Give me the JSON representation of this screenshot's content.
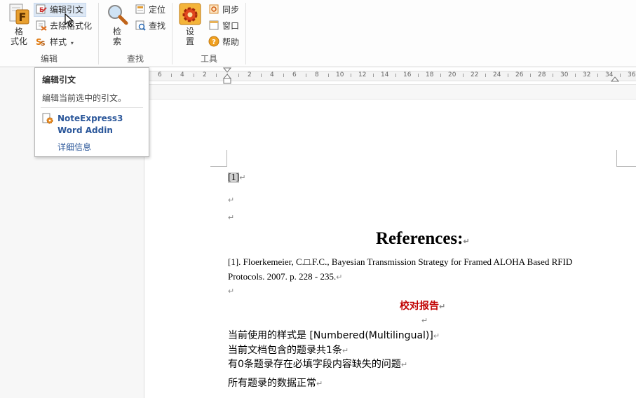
{
  "ribbon": {
    "groups": [
      {
        "label": "编辑"
      },
      {
        "label": "查找"
      },
      {
        "label": "工具"
      }
    ],
    "format_button": {
      "line1": "格",
      "line2": "式化"
    },
    "edit_citation": "编辑引文",
    "remove_format": "去除格式化",
    "style": "样式",
    "search_button": {
      "line1": "检",
      "line2": "索"
    },
    "locate": "定位",
    "find": "查找",
    "settings_button": {
      "line1": "设",
      "line2": "置"
    },
    "sync": "同步",
    "window": "窗口",
    "help": "帮助"
  },
  "ruler": {
    "numbers": [
      "6",
      "4",
      "2",
      "2",
      "4",
      "6",
      "8",
      "10",
      "12",
      "14",
      "16",
      "18",
      "20",
      "22",
      "24",
      "26",
      "28",
      "30",
      "32",
      "34",
      "36"
    ]
  },
  "tooltip": {
    "title": "编辑引文",
    "description": "编辑当前选中的引文。",
    "addin_name": "NoteExpress3 Word Addin",
    "more_info": "详细信息"
  },
  "document": {
    "citation": "[1]",
    "references_heading": "References:",
    "reference_line1": "[1]. Floerkemeier, C.□.F.C., Bayesian Transmission Strategy for Framed ALOHA Based RFID",
    "reference_line2": "Protocols. 2007. p. 228 - 235.",
    "proof_heading": "校对报告",
    "report": [
      "当前使用的样式是  [Numbered(Multilingual)]",
      "当前文档包含的题录共1条",
      "有0条题录存在必填字段内容缺失的问题",
      "所有题录的数据正常"
    ],
    "paragraph_mark": "↵"
  },
  "colors": {
    "accent_blue": "#2b579a",
    "proof_red": "#c00000",
    "selection_gray": "#cfcfcf"
  }
}
